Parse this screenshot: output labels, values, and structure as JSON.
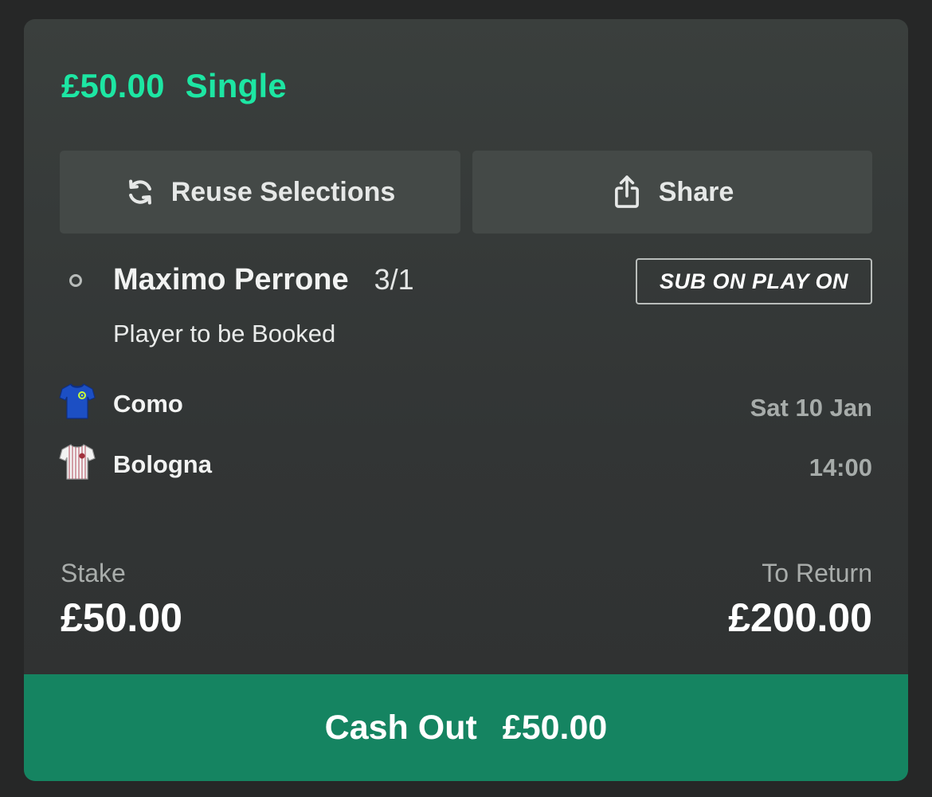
{
  "bet": {
    "stake_amount": "£50.00",
    "bet_type": "Single"
  },
  "actions": {
    "reuse_label": "Reuse Selections",
    "share_label": "Share"
  },
  "selection": {
    "name": "Maximo Perrone",
    "odds": "3/1",
    "badge": "SUB ON PLAY ON",
    "market": "Player to be Booked"
  },
  "event": {
    "home_team": "Como",
    "away_team": "Bologna",
    "date": "Sat 10 Jan",
    "time": "14:00"
  },
  "summary": {
    "stake_label": "Stake",
    "stake_value": "£50.00",
    "return_label": "To Return",
    "return_value": "£200.00"
  },
  "cashout": {
    "label": "Cash Out",
    "amount": "£50.00"
  },
  "icons": {
    "reuse": "refresh-icon",
    "share": "share-icon",
    "home_kit": "shirt-icon",
    "away_kit": "shirt-icon"
  },
  "colors": {
    "accent": "#1de6a3",
    "cashout_bg": "#158461",
    "card_bg": "#353938",
    "button_bg": "#444947"
  }
}
